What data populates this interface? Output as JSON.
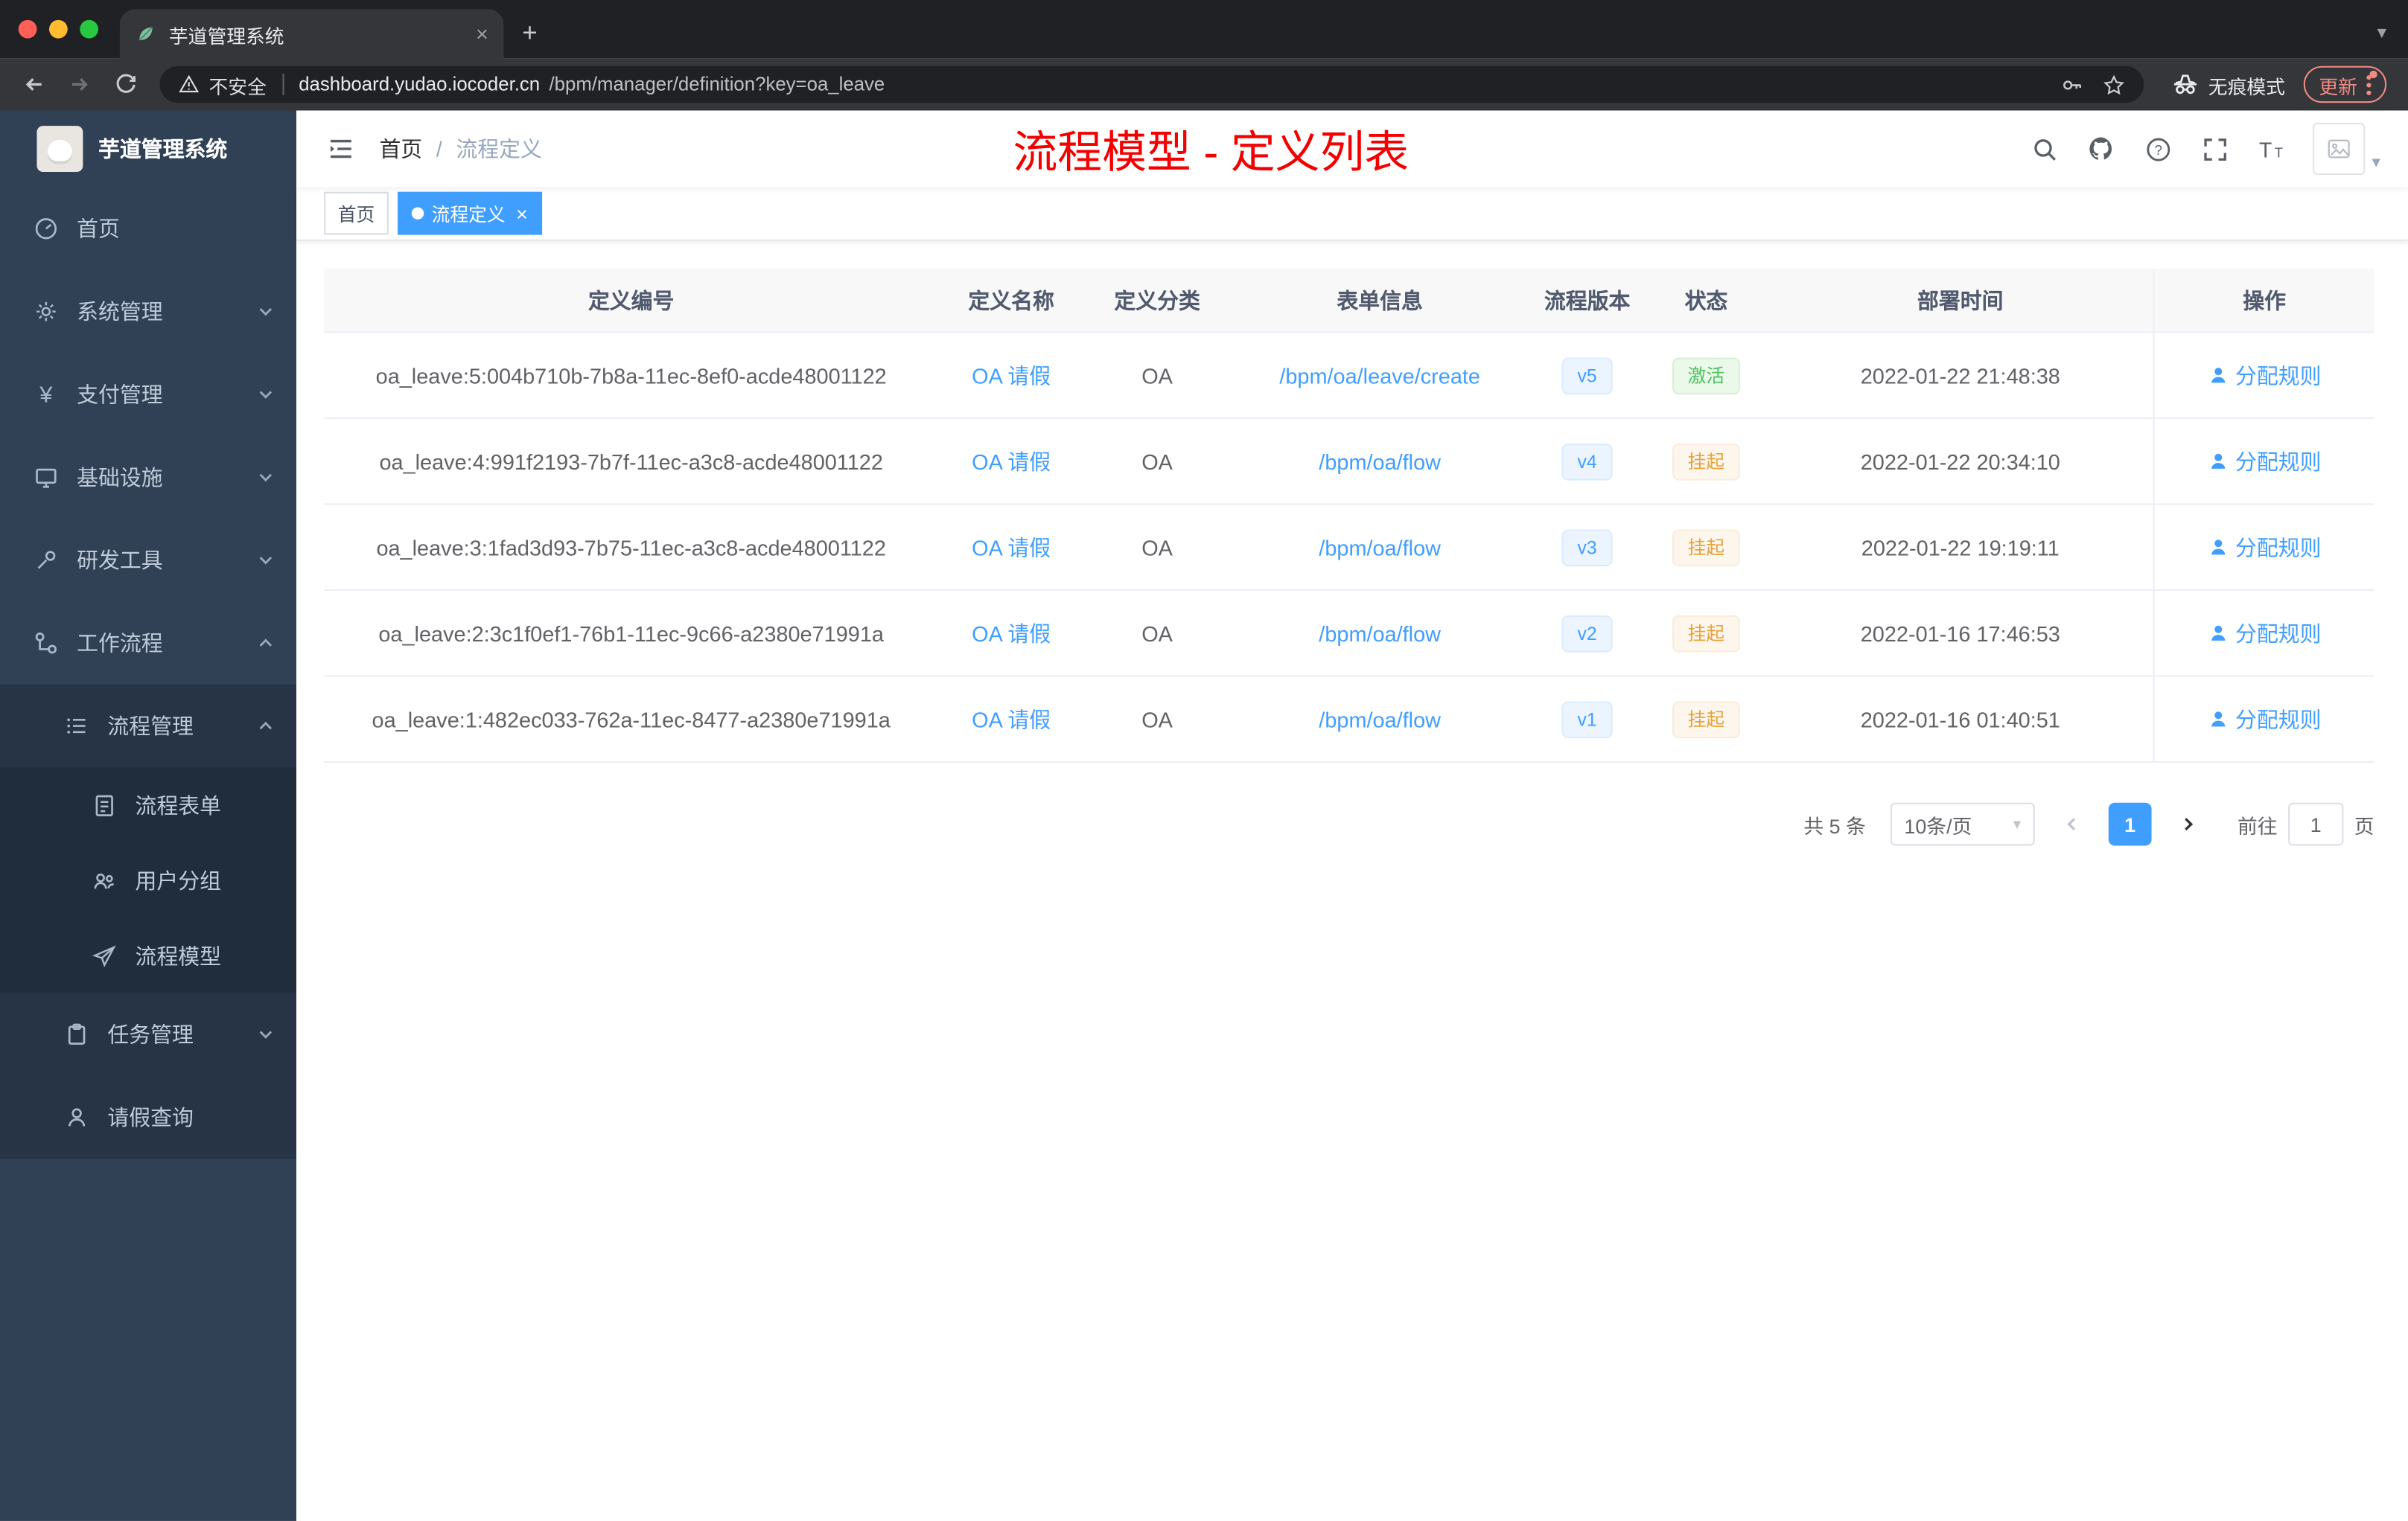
{
  "colors": {
    "accent": "#409eff",
    "success_text": "#4fc05f",
    "warning_text": "#e6a23c",
    "annotation_red": "#f40000",
    "sidebar_bg": "#304156",
    "submenu_bg": "#1f2d3d"
  },
  "icons": {
    "new_tab": "+",
    "close": "×",
    "caret_down": "▾",
    "yen": "¥",
    "question": "?"
  },
  "browser": {
    "tab_title": "芋道管理系统",
    "security_label": "不安全",
    "url_host": "dashboard.yudao.iocoder.cn",
    "url_path": "/bpm/manager/definition?key=oa_leave",
    "incognito_label": "无痕模式",
    "update_label": "更新"
  },
  "sidebar": {
    "logo_title": "芋道管理系统",
    "items": [
      {
        "label": "首页"
      },
      {
        "label": "系统管理"
      },
      {
        "label": "支付管理"
      },
      {
        "label": "基础设施"
      },
      {
        "label": "研发工具"
      },
      {
        "label": "工作流程"
      },
      {
        "label": "流程管理"
      },
      {
        "label": "流程表单"
      },
      {
        "label": "用户分组"
      },
      {
        "label": "流程模型"
      },
      {
        "label": "任务管理"
      },
      {
        "label": "请假查询"
      }
    ]
  },
  "header": {
    "breadcrumb_home": "首页",
    "breadcrumb_sep": "/",
    "breadcrumb_current": "流程定义",
    "annotation": "流程模型 - 定义列表"
  },
  "tags": {
    "home": "首页",
    "active": "流程定义"
  },
  "table": {
    "columns": [
      "定义编号",
      "定义名称",
      "定义分类",
      "表单信息",
      "流程版本",
      "状态",
      "部署时间",
      "操作"
    ],
    "rows": [
      {
        "id": "oa_leave:5:004b710b-7b8a-11ec-8ef0-acde48001122",
        "name": "OA 请假",
        "category": "OA",
        "form": "/bpm/oa/leave/create",
        "version": "v5",
        "status": "激活",
        "status_type": "success",
        "deploy_time": "2022-01-22 21:48:38",
        "action": "分配规则"
      },
      {
        "id": "oa_leave:4:991f2193-7b7f-11ec-a3c8-acde48001122",
        "name": "OA 请假",
        "category": "OA",
        "form": "/bpm/oa/flow",
        "version": "v4",
        "status": "挂起",
        "status_type": "warning",
        "deploy_time": "2022-01-22 20:34:10",
        "action": "分配规则"
      },
      {
        "id": "oa_leave:3:1fad3d93-7b75-11ec-a3c8-acde48001122",
        "name": "OA 请假",
        "category": "OA",
        "form": "/bpm/oa/flow",
        "version": "v3",
        "status": "挂起",
        "status_type": "warning",
        "deploy_time": "2022-01-22 19:19:11",
        "action": "分配规则"
      },
      {
        "id": "oa_leave:2:3c1f0ef1-76b1-11ec-9c66-a2380e71991a",
        "name": "OA 请假",
        "category": "OA",
        "form": "/bpm/oa/flow",
        "version": "v2",
        "status": "挂起",
        "status_type": "warning",
        "deploy_time": "2022-01-16 17:46:53",
        "action": "分配规则"
      },
      {
        "id": "oa_leave:1:482ec033-762a-11ec-8477-a2380e71991a",
        "name": "OA 请假",
        "category": "OA",
        "form": "/bpm/oa/flow",
        "version": "v1",
        "status": "挂起",
        "status_type": "warning",
        "deploy_time": "2022-01-16 01:40:51",
        "action": "分配规则"
      }
    ]
  },
  "pagination": {
    "total": "共 5 条",
    "page_size": "10条/页",
    "current": "1",
    "goto_label": "前往",
    "goto_value": "1",
    "unit": "页"
  }
}
